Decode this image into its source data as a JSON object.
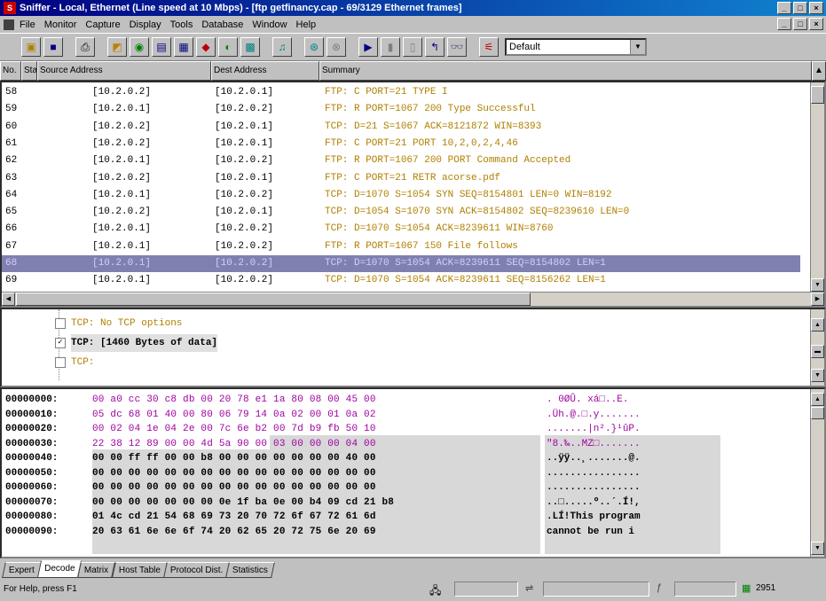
{
  "window": {
    "title": "Sniffer - Local, Ethernet (Line speed at 10 Mbps) - [ftp getfinancy.cap - 69/3129 Ethernet frames]",
    "icon": "sniffer-app-icon",
    "buttons": [
      "_",
      "□",
      "×"
    ]
  },
  "menu": {
    "items": [
      "File",
      "Monitor",
      "Capture",
      "Display",
      "Tools",
      "Database",
      "Window",
      "Help"
    ],
    "mdi_buttons": [
      "_",
      "□",
      "×"
    ]
  },
  "toolbar": {
    "buttons": [
      "open-icon",
      "save-icon",
      "print-icon",
      "filter-icon",
      "dashboard-icon",
      "host-table-icon",
      "matrix-icon",
      "art-icon",
      "history-icon",
      "alarm-icon",
      "protocol-icon",
      "define-filter-icon",
      "start-icon",
      "pause-icon",
      "stop-icon",
      "stop-display-icon",
      "find-icon",
      "expert-icon"
    ],
    "profile": "Default"
  },
  "packet_list": {
    "columns": [
      "No.",
      "Status",
      "Source Address",
      "Dest Address",
      "Summary"
    ],
    "rows": [
      {
        "no": "58",
        "src": "[10.2.0.2]",
        "dst": "[10.2.0.1]",
        "summary": "FTP: C PORT=21   TYPE I"
      },
      {
        "no": "59",
        "src": "[10.2.0.1]",
        "dst": "[10.2.0.2]",
        "summary": "FTP: R PORT=1067   200 Type Successful"
      },
      {
        "no": "60",
        "src": "[10.2.0.2]",
        "dst": "[10.2.0.1]",
        "summary": "TCP: D=21 S=1067     ACK=8121872 WIN=8393"
      },
      {
        "no": "61",
        "src": "[10.2.0.2]",
        "dst": "[10.2.0.1]",
        "summary": "FTP: C PORT=21    PORT 10,2,0,2,4,46"
      },
      {
        "no": "62",
        "src": "[10.2.0.1]",
        "dst": "[10.2.0.2]",
        "summary": "FTP: R PORT=1067    200 PORT Command Accepted"
      },
      {
        "no": "63",
        "src": "[10.2.0.2]",
        "dst": "[10.2.0.1]",
        "summary": "FTP: C PORT=21    RETR acorse.pdf"
      },
      {
        "no": "64",
        "src": "[10.2.0.1]",
        "dst": "[10.2.0.2]",
        "summary": "TCP: D=1070 S=1054 SYN SEQ=8154801 LEN=0 WIN=8192"
      },
      {
        "no": "65",
        "src": "[10.2.0.2]",
        "dst": "[10.2.0.1]",
        "summary": "TCP: D=1054 S=1070 SYN ACK=8154802 SEQ=8239610 LEN=0"
      },
      {
        "no": "66",
        "src": "[10.2.0.1]",
        "dst": "[10.2.0.2]",
        "summary": "TCP: D=1070 S=1054      ACK=8239611 WIN=8760"
      },
      {
        "no": "67",
        "src": "[10.2.0.1]",
        "dst": "[10.2.0.2]",
        "summary": "FTP: R PORT=1067    150 File follows"
      },
      {
        "no": "68",
        "src": "[10.2.0.1]",
        "dst": "[10.2.0.2]",
        "summary": "TCP: D=1070 S=1054      ACK=8239611 SEQ=8154802 LEN=1",
        "selected": true
      },
      {
        "no": "69",
        "src": "[10.2.0.1]",
        "dst": "[10.2.0.2]",
        "summary": "TCP: D=1070 S=1054      ACK=8239611 SEQ=8156262 LEN=1"
      }
    ]
  },
  "decode": {
    "lines": [
      {
        "text": "TCP: No TCP options",
        "bold": false
      },
      {
        "text": "TCP: [1460 Bytes of data]",
        "bold": true
      },
      {
        "text": "TCP:",
        "bold": false
      }
    ]
  },
  "hex": {
    "rows": [
      {
        "off": "00000000:",
        "bytes": "00 a0 cc 30 c8 db 00 20 78 e1 1a 80 08 00 45 00",
        "ascii": ". 0ØÛ. xá□..E."
      },
      {
        "off": "00000010:",
        "bytes": "05 dc 68 01 40 00 80 06 79 14 0a 02 00 01 0a 02",
        "ascii": ".Üh.@.□.y......."
      },
      {
        "off": "00000020:",
        "bytes": "00 02 04 1e 04 2e 00 7c 6e b2 00 7d b9 fb 50 10",
        "ascii": ".......|n².}¹ûP."
      },
      {
        "off": "00000030:",
        "bytes": "22 38 12 89 00 00 4d 5a 90 00 03 00 00 00 04 00",
        "ascii": "\"8.‰..MZ□......."
      },
      {
        "off": "00000040:",
        "bytes": "00 00 ff ff 00 00 b8 00 00 00 00 00 00 00 40 00",
        "ascii": "..ÿÿ..¸.......@."
      },
      {
        "off": "00000050:",
        "bytes": "00 00 00 00 00 00 00 00 00 00 00 00 00 00 00 00",
        "ascii": "................"
      },
      {
        "off": "00000060:",
        "bytes": "00 00 00 00 00 00 00 00 00 00 00 00 00 00 00 00",
        "ascii": "................"
      },
      {
        "off": "00000070:",
        "bytes": "00 00 00 00 00 00 00 0e 1f ba 0e 00 b4 09 cd 21 b8",
        "ascii": "..□.....º..´.Í!,"
      },
      {
        "off": "00000080:",
        "bytes": "01 4c cd 21 54 68 69 73 20 70 72 6f 67 72 61 6d",
        "ascii": ".LÍ!This program"
      },
      {
        "off": "00000090:",
        "bytes": "20 63 61 6e 6e 6f 74 20 62 65 20 72 75 6e 20 69",
        "ascii": " cannot be run i"
      }
    ]
  },
  "tabs": [
    "Expert",
    "Decode",
    "Matrix",
    "Host Table",
    "Protocol Dist.",
    "Statistics"
  ],
  "status": {
    "help": "For Help, press F1",
    "count": "2951"
  }
}
